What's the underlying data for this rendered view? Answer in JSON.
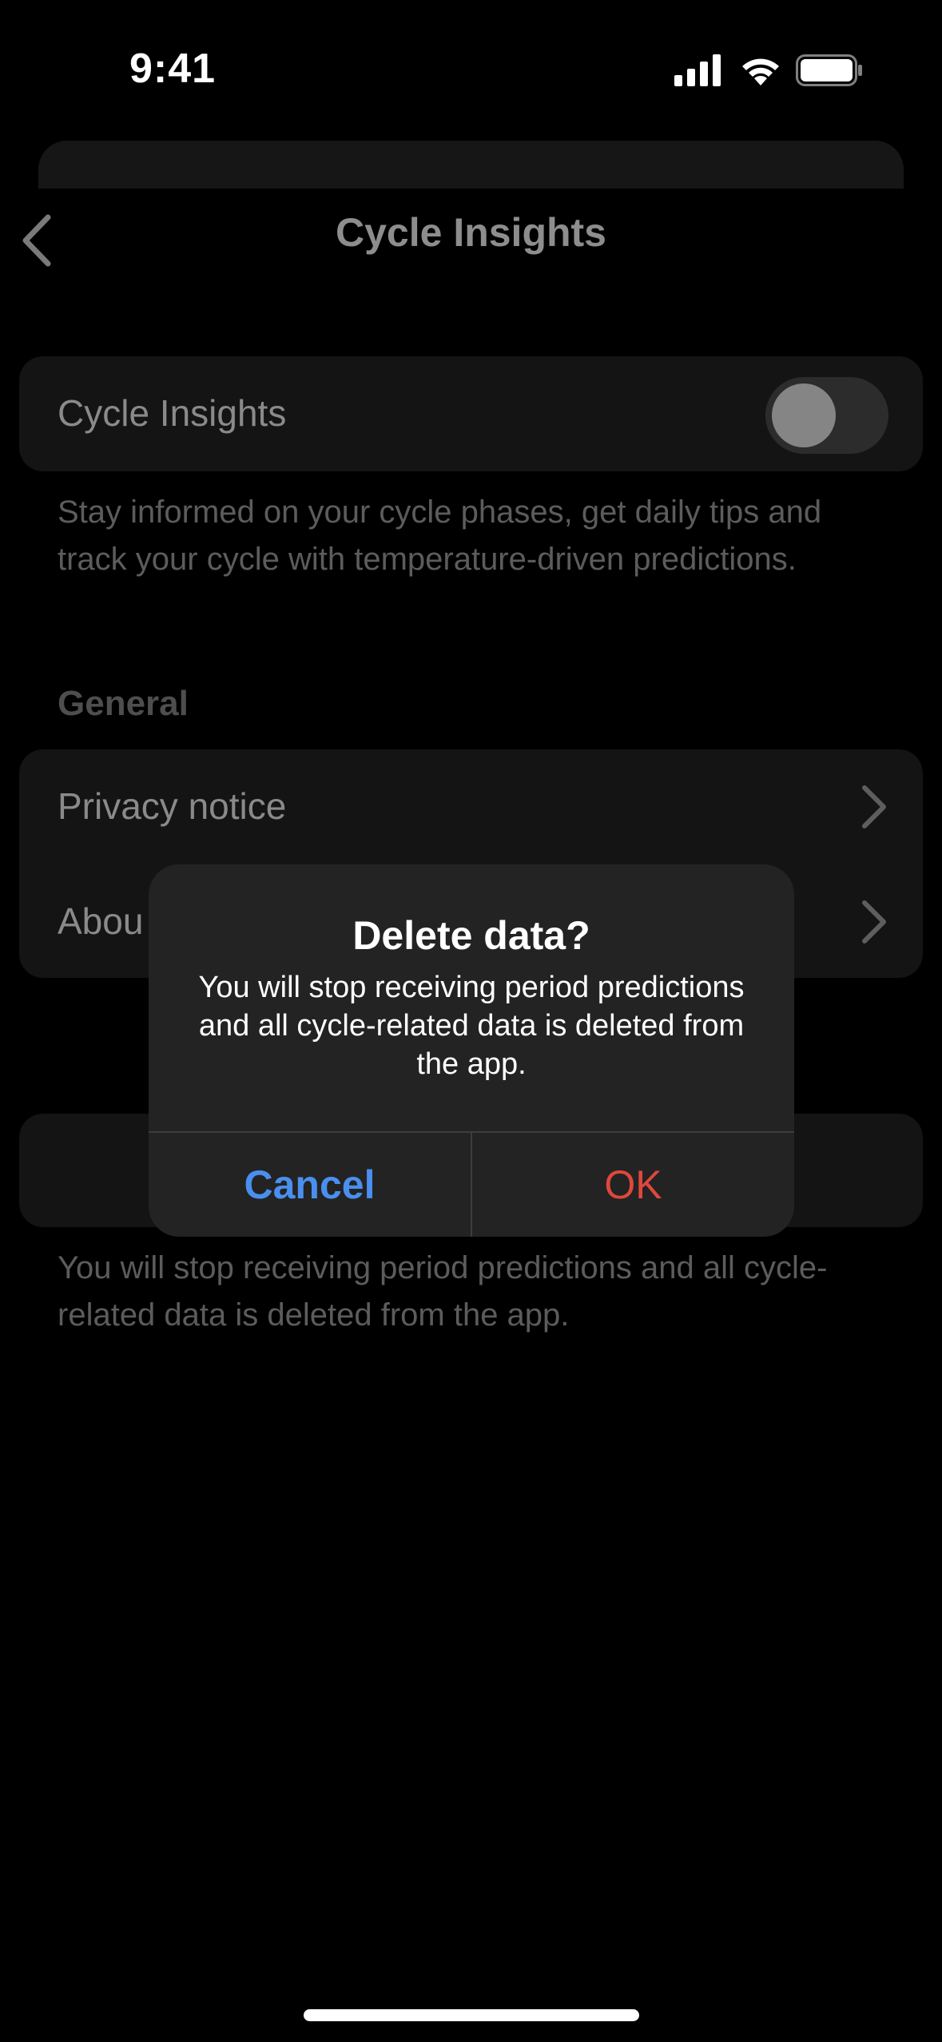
{
  "status_bar": {
    "time": "9:41",
    "icons": [
      "cellular-signal-icon",
      "wifi-icon",
      "battery-icon"
    ]
  },
  "nav": {
    "title": "Cycle Insights",
    "back_icon": "chevron-left-icon"
  },
  "toggle_card": {
    "label": "Cycle Insights",
    "enabled": false
  },
  "toggle_description": "Stay informed on your cycle phases, get daily tips and track your cycle with temperature-driven predictions.",
  "general": {
    "heading": "General",
    "items": [
      {
        "label": "Privacy notice",
        "icon": "chevron-right-icon"
      },
      {
        "label": "Abou",
        "icon": "chevron-right-icon"
      }
    ]
  },
  "delete_description": "You will stop receiving period predictions and all cycle-related data is deleted from the app.",
  "alert": {
    "title": "Delete data?",
    "message": "You will stop receiving period predictions and all cycle-related data is deleted from the app.",
    "cancel_label": "Cancel",
    "ok_label": "OK"
  },
  "colors": {
    "cancel": "#4a8ff0",
    "ok": "#e0473c",
    "alert_bg": "#232323"
  }
}
